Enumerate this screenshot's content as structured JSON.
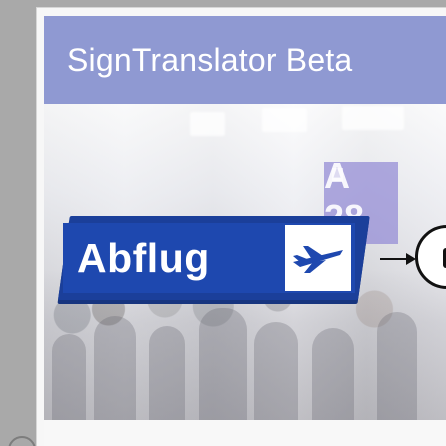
{
  "app": {
    "title": "SignTranslator Beta"
  },
  "hero": {
    "gate_label": "A 28",
    "sign_text": "Abflug"
  },
  "icons": {
    "plane": "airplane-icon",
    "camera": "camera-icon",
    "arrow": "arrow-right-icon",
    "radio": "radio-button-icon"
  },
  "colors": {
    "appbar": "#8f99d2",
    "sign_blue": "#1e48af",
    "sign_dark_blue": "#1b3f9a",
    "background": "#a9a9a9"
  }
}
